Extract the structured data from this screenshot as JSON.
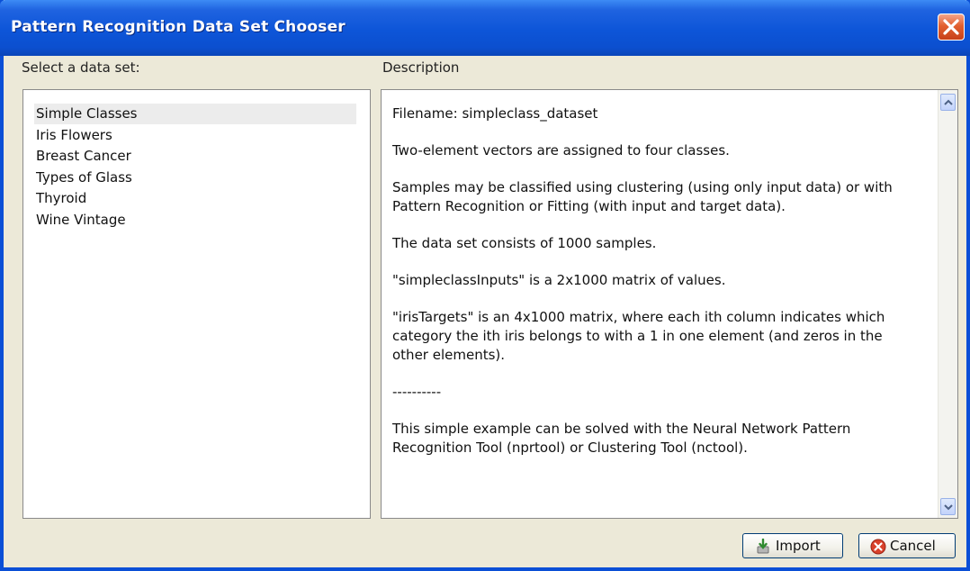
{
  "window": {
    "title": "Pattern Recognition Data Set Chooser"
  },
  "left": {
    "label": "Select a data set:",
    "items": [
      {
        "label": "Simple Classes",
        "selected": true
      },
      {
        "label": "Iris Flowers",
        "selected": false
      },
      {
        "label": "Breast Cancer",
        "selected": false
      },
      {
        "label": "Types of Glass",
        "selected": false
      },
      {
        "label": "Thyroid",
        "selected": false
      },
      {
        "label": "Wine Vintage",
        "selected": false
      }
    ]
  },
  "right": {
    "label": "Description",
    "paragraphs": [
      "Filename: simpleclass_dataset",
      "Two-element vectors are assigned to four classes.",
      "Samples may be classified using clustering (using only input data) or with Pattern Recognition or Fitting (with input and target data).",
      "The data set consists of 1000 samples.",
      "\"simpleclassInputs\" is a 2x1000 matrix of values.",
      "\"irisTargets\" is an 4x1000 matrix, where each ith column indicates which category the ith iris belongs to with a 1 in one element (and zeros in the other elements).",
      "----------",
      "This simple example can be solved with the Neural Network Pattern Recognition Tool (nprtool) or Clustering Tool (nctool)."
    ]
  },
  "buttons": {
    "import_label": "Import",
    "cancel_label": "Cancel"
  },
  "icons": {
    "close": "close-icon",
    "import": "import-icon",
    "cancel": "cancel-icon",
    "scroll_up": "chevron-up-icon",
    "scroll_down": "chevron-down-icon"
  },
  "colors": {
    "titlebar": "#0d55d8",
    "close_button": "#e2602f",
    "selection": "#ececec",
    "dialog_bg": "#ece9d8"
  }
}
